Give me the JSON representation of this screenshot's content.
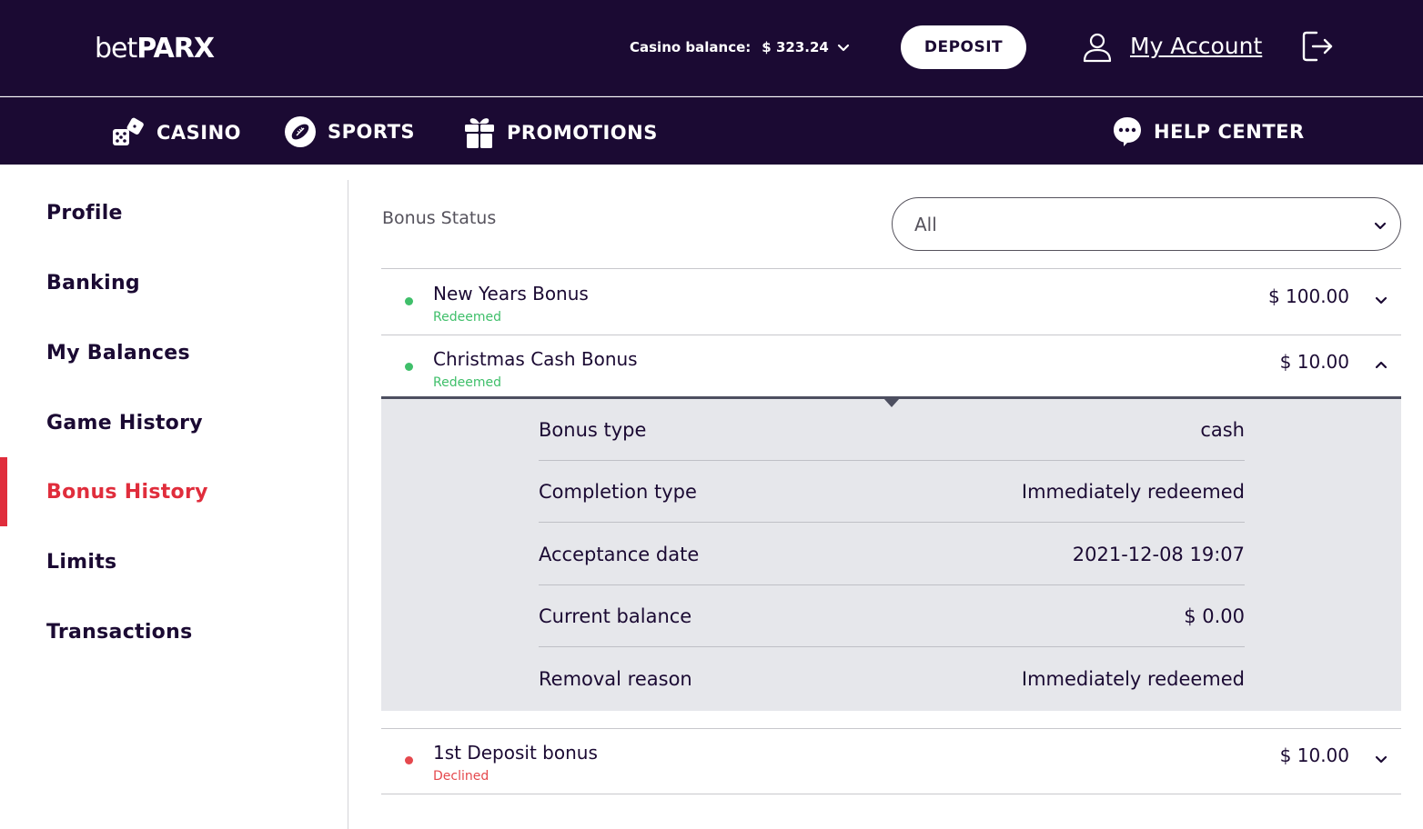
{
  "header": {
    "logo_light": "bet",
    "logo_bold": "PARX",
    "balance_label": "Casino balance:",
    "balance_value": "$ 323.24",
    "deposit_label": "DEPOSIT",
    "account_label": "My Account"
  },
  "nav": {
    "casino": "CASINO",
    "sports": "SPORTS",
    "promotions": "PROMOTIONS",
    "help": "HELP CENTER"
  },
  "sidebar": {
    "items": [
      {
        "label": "Profile"
      },
      {
        "label": "Banking"
      },
      {
        "label": "My Balances"
      },
      {
        "label": "Game History"
      },
      {
        "label": "Bonus History"
      },
      {
        "label": "Limits"
      },
      {
        "label": "Transactions"
      }
    ],
    "active_index": 4
  },
  "filter": {
    "label": "Bonus Status",
    "value": "All"
  },
  "bonuses": [
    {
      "name": "New Years Bonus",
      "status": "Redeemed",
      "amount": "$ 100.00",
      "status_color": "#3fbf6a",
      "expanded": false
    },
    {
      "name": "Christmas Cash Bonus",
      "status": "Redeemed",
      "amount": "$ 10.00",
      "status_color": "#3fbf6a",
      "expanded": true
    },
    {
      "name": "1st Deposit bonus",
      "status": "Declined",
      "amount": "$ 10.00",
      "status_color": "#e5484d",
      "expanded": false
    }
  ],
  "details": [
    {
      "key": "Bonus type",
      "value": "cash"
    },
    {
      "key": "Completion type",
      "value": "Immediately redeemed"
    },
    {
      "key": "Acceptance date",
      "value": "2021-12-08 19:07"
    },
    {
      "key": "Current balance",
      "value": "$ 0.00"
    },
    {
      "key": "Removal reason",
      "value": "Immediately redeemed"
    }
  ],
  "colors": {
    "brand_dark": "#1b0a33",
    "accent_red": "#e02d3c",
    "redeemed_green": "#3fbf6a",
    "declined_red": "#e5484d"
  }
}
